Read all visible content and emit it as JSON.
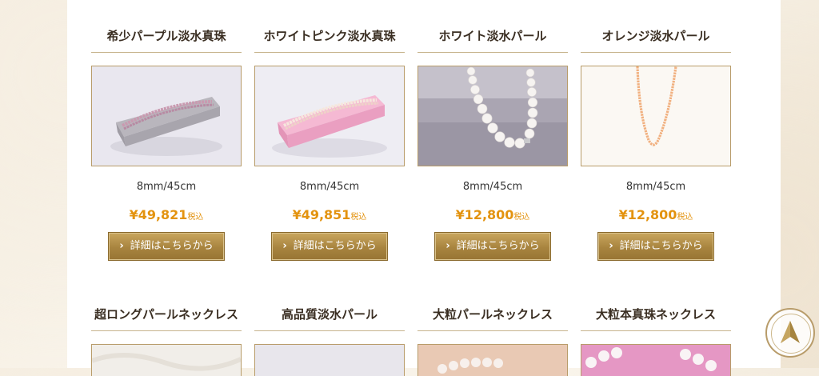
{
  "products_row1": [
    {
      "name": "希少パープル淡水真珠",
      "size": "8mm/45cm",
      "price": "¥49,821",
      "tax": "税込",
      "button": "詳細はこちらから"
    },
    {
      "name": "ホワイトピンク淡水真珠",
      "size": "8mm/45cm",
      "price": "¥49,851",
      "tax": "税込",
      "button": "詳細はこちらから"
    },
    {
      "name": "ホワイト淡水パール",
      "size": "8mm/45cm",
      "price": "¥12,800",
      "tax": "税込",
      "button": "詳細はこちらから"
    },
    {
      "name": "オレンジ淡水パール",
      "size": "8mm/45cm",
      "price": "¥12,800",
      "tax": "税込",
      "button": "詳細はこちらから"
    }
  ],
  "products_row2": [
    {
      "name": "超ロングパールネックレス"
    },
    {
      "name": "高品質淡水パール"
    },
    {
      "name": "大粒パールネックレス"
    },
    {
      "name": "大粒本真珠ネックレス"
    }
  ],
  "colors": {
    "price": "#e3930f",
    "button": "#a8843f",
    "rule": "#c7b48d"
  },
  "icons": {
    "button_arrow": "chevron-right-icon",
    "page_top": "arrow-up-icon"
  }
}
